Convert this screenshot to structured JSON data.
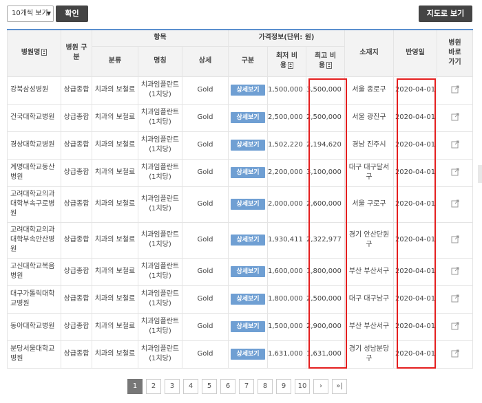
{
  "toolbar": {
    "page_size_label": "10개씩 보기",
    "confirm_label": "확인",
    "map_view_label": "지도로 보기"
  },
  "table": {
    "headers": {
      "hospital_name": "병원명",
      "hospital_type": "병원 구분",
      "item_group": "항목",
      "price_group": "가격정보(단위: 원)",
      "location": "소재지",
      "reflect_date": "반영일",
      "hospital_link": "병원 바로 가기",
      "category": "분류",
      "name": "명칭",
      "detail": "상세",
      "division": "구분",
      "min_cost": "최저 비용",
      "max_cost": "최고 비용"
    },
    "rows": [
      {
        "hospital": "강북삼성병원",
        "type": "상급종합",
        "category": "치과의 보철료",
        "name": "치과임플란트 (1치당)",
        "detail": "Gold",
        "button": "상세보기",
        "min": "1,500,000",
        "max": "3,500,000",
        "location": "서울 종로구",
        "date": "2020-04-01"
      },
      {
        "hospital": "건국대학교병원",
        "type": "상급종합",
        "category": "치과의 보철료",
        "name": "치과임플란트 (1치당)",
        "detail": "Gold",
        "button": "상세보기",
        "min": "2,500,000",
        "max": "2,500,000",
        "location": "서울 광진구",
        "date": "2020-04-01"
      },
      {
        "hospital": "경상대학교병원",
        "type": "상급종합",
        "category": "치과의 보철료",
        "name": "치과임플란트 (1치당)",
        "detail": "Gold",
        "button": "상세보기",
        "min": "1,502,220",
        "max": "2,194,620",
        "location": "경남 진주시",
        "date": "2020-04-01"
      },
      {
        "hospital": "계명대학교동산 병원",
        "type": "상급종합",
        "category": "치과의 보철료",
        "name": "치과임플란트 (1치당)",
        "detail": "Gold",
        "button": "상세보기",
        "min": "2,200,000",
        "max": "3,100,000",
        "location": "대구 대구달서 구",
        "date": "2020-04-01"
      },
      {
        "hospital": "고려대학교의과 대학부속구로병 원",
        "type": "상급종합",
        "category": "치과의 보철료",
        "name": "치과임플란트 (1치당)",
        "detail": "Gold",
        "button": "상세보기",
        "min": "2,000,000",
        "max": "2,600,000",
        "location": "서울 구로구",
        "date": "2020-04-01"
      },
      {
        "hospital": "고려대학교의과 대학부속안산병 원",
        "type": "상급종합",
        "category": "치과의 보철료",
        "name": "치과임플란트 (1치당)",
        "detail": "Gold",
        "button": "상세보기",
        "min": "1,930,411",
        "max": "2,322,977",
        "location": "경기 안산단원 구",
        "date": "2020-04-01"
      },
      {
        "hospital": "고신대학교복음 병원",
        "type": "상급종합",
        "category": "치과의 보철료",
        "name": "치과임플란트 (1치당)",
        "detail": "Gold",
        "button": "상세보기",
        "min": "1,600,000",
        "max": "1,800,000",
        "location": "부산 부산서구",
        "date": "2020-04-01"
      },
      {
        "hospital": "대구가톨릭대학 교병원",
        "type": "상급종합",
        "category": "치과의 보철료",
        "name": "치과임플란트 (1치당)",
        "detail": "Gold",
        "button": "상세보기",
        "min": "1,800,000",
        "max": "2,500,000",
        "location": "대구 대구남구",
        "date": "2020-04-01"
      },
      {
        "hospital": "동아대학교병원",
        "type": "상급종합",
        "category": "치과의 보철료",
        "name": "치과임플란트 (1치당)",
        "detail": "Gold",
        "button": "상세보기",
        "min": "1,500,000",
        "max": "2,900,000",
        "location": "부산 부산서구",
        "date": "2020-04-01"
      },
      {
        "hospital": "분당서울대학교 병원",
        "type": "상급종합",
        "category": "치과의 보철료",
        "name": "치과임플란트 (1치당)",
        "detail": "Gold",
        "button": "상세보기",
        "min": "1,631,000",
        "max": "1,631,000",
        "location": "경기 성남분당 구",
        "date": "2020-04-01"
      }
    ]
  },
  "pagination": {
    "pages": [
      "1",
      "2",
      "3",
      "4",
      "5",
      "6",
      "7",
      "8",
      "9",
      "10"
    ],
    "current": "1",
    "next": "›",
    "last": "»|"
  },
  "colors": {
    "header_accent": "#5a8fce",
    "detail_button": "#6f9fd3",
    "highlight": "#e41e1e",
    "dark_button": "#444444"
  }
}
